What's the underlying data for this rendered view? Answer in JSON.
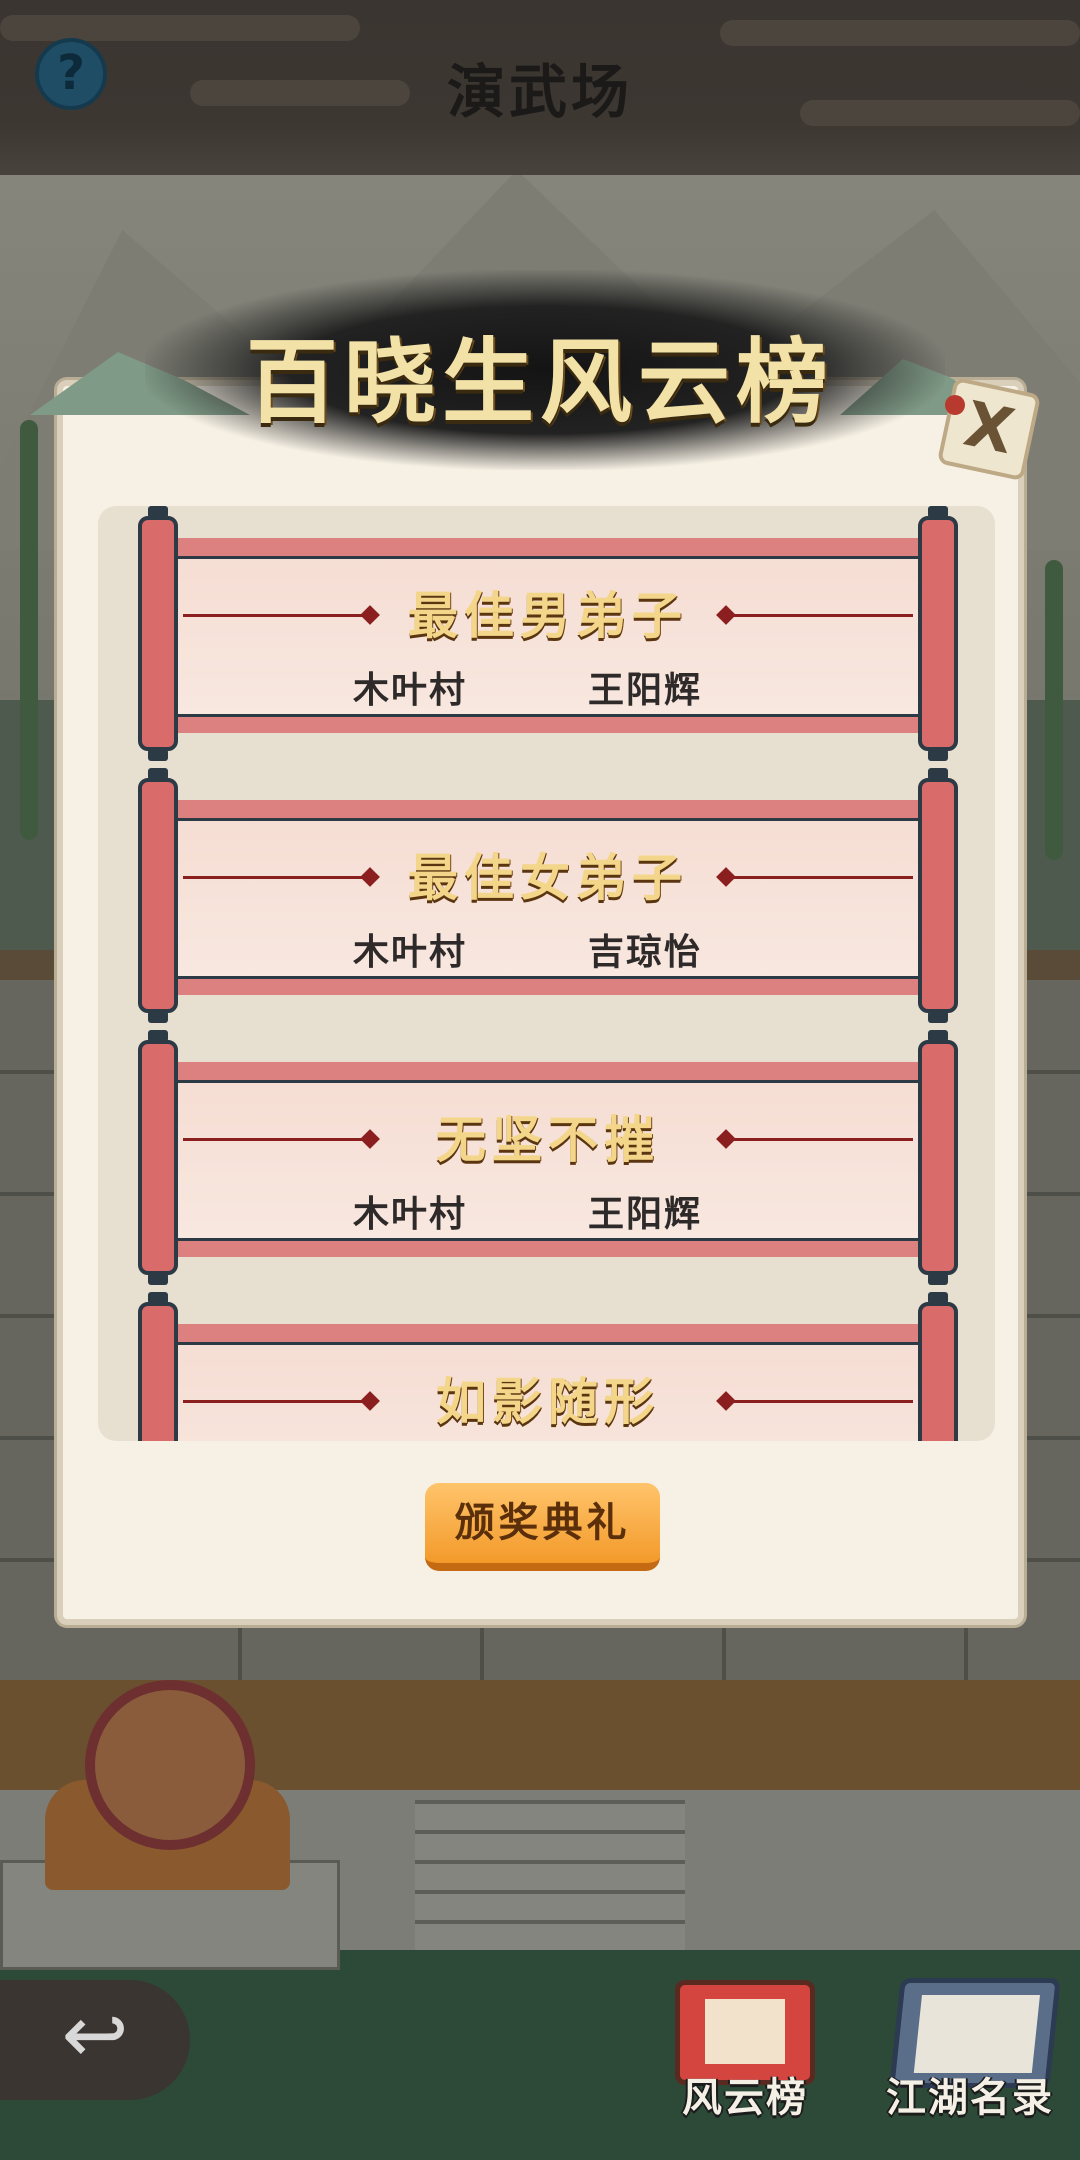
{
  "header": {
    "title": "演武场",
    "help_icon": "?"
  },
  "panel": {
    "title": "百晓生风云榜",
    "close_icon": "X",
    "awards": [
      {
        "title": "最佳男弟子",
        "village": "木叶村",
        "winner": "王阳辉"
      },
      {
        "title": "最佳女弟子",
        "village": "木叶村",
        "winner": "吉琼怡"
      },
      {
        "title": "无坚不摧",
        "village": "木叶村",
        "winner": "王阳辉"
      },
      {
        "title": "如影随形",
        "village": "",
        "winner": ""
      }
    ],
    "ceremony_button": "颁奖典礼"
  },
  "bottom_nav": {
    "back_icon": "↩",
    "items": [
      {
        "label": "风云榜",
        "icon": "scroll-icon"
      },
      {
        "label": "江湖名录",
        "icon": "book-icon"
      }
    ]
  },
  "colors": {
    "accent": "#f39a2a",
    "scroll_red": "#dd8080",
    "panel_bg": "#f7f1e5"
  }
}
